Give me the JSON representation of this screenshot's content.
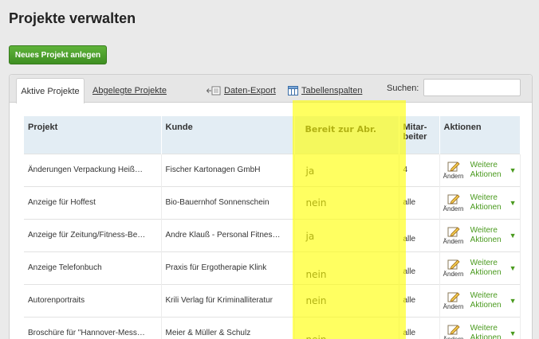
{
  "page": {
    "title": "Projekte verwalten"
  },
  "actions": {
    "new_project": "Neues Projekt anlegen"
  },
  "tabs": {
    "active": "Aktive Projekte",
    "archived": "Abgelegte Projekte"
  },
  "toolbar": {
    "export": "Daten-Export",
    "columns": "Tabellenspalten",
    "search_label": "Suchen:",
    "search_value": ""
  },
  "table": {
    "headers": {
      "project": "Projekt",
      "client": "Kunde",
      "billing": "Bereit zur Abr.",
      "staff_1": "Mitar-",
      "staff_2": "beiter",
      "actions": "Aktionen"
    },
    "edit_label": "Ändern",
    "more_1": "Weitere",
    "more_2": "Aktionen",
    "rows": [
      {
        "project": "Änderungen Verpackung Heiß…",
        "client": "Fischer Kartonagen GmbH",
        "billing": "ja",
        "staff": "4"
      },
      {
        "project": "Anzeige für Hoffest",
        "client": "Bio-Bauernhof Sonnenschein",
        "billing": "nein",
        "staff": "alle"
      },
      {
        "project": "Anzeige für Zeitung/Fitness-Be…",
        "client": "Andre Klauß - Personal Fitnes…",
        "billing": "ja",
        "staff": "alle"
      },
      {
        "project": "Anzeige Telefonbuch",
        "client": "Praxis für Ergotherapie Klink",
        "billing": "nein",
        "staff": "alle"
      },
      {
        "project": "Autorenportraits",
        "client": "Krili Verlag für Kriminalliteratur",
        "billing": "nein",
        "staff": "alle"
      },
      {
        "project": "Broschüre für \"Hannover-Mess…",
        "client": "Meier & Müller & Schulz",
        "billing": "nein",
        "staff": "alle"
      }
    ]
  },
  "colors": {
    "accent_green": "#4a9a1e",
    "header_blue": "#e3edf4",
    "highlight_yellow": "#ffff00"
  }
}
